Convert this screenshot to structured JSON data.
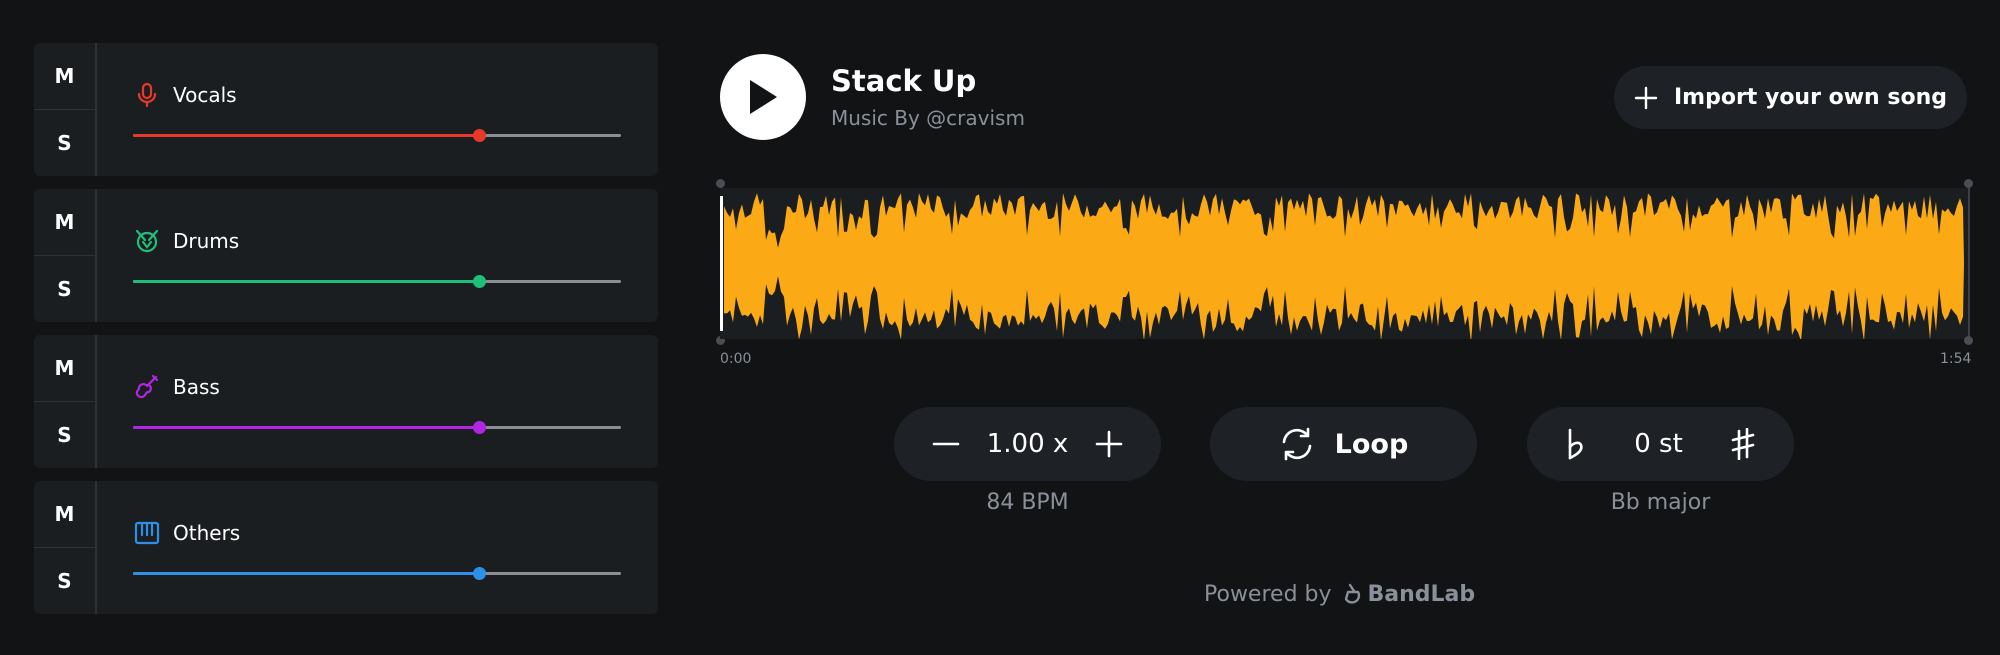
{
  "tracks": [
    {
      "mute_label": "M",
      "solo_label": "S",
      "name": "Vocals",
      "icon": "microphone-icon",
      "color": "#e8382b",
      "volume": 0.71
    },
    {
      "mute_label": "M",
      "solo_label": "S",
      "name": "Drums",
      "icon": "drum-icon",
      "color": "#1fbf7a",
      "volume": 0.71
    },
    {
      "mute_label": "M",
      "solo_label": "S",
      "name": "Bass",
      "icon": "bass-guitar-icon",
      "color": "#b026e3",
      "volume": 0.71
    },
    {
      "mute_label": "M",
      "solo_label": "S",
      "name": "Others",
      "icon": "piano-keys-icon",
      "color": "#2f8fe8",
      "volume": 0.71
    }
  ],
  "player": {
    "title": "Stack Up",
    "artist": "Music By @cravism",
    "import_label": "Import your own song",
    "waveform_color": "#fbaa15",
    "time_start": "0:00",
    "time_end": "1:54"
  },
  "controls": {
    "speed_value": "1.00 x",
    "bpm": "84 BPM",
    "loop_label": "Loop",
    "pitch_value": "0 st",
    "key": "Bb major"
  },
  "footer": {
    "powered_by": "Powered by",
    "brand": "BandLab"
  }
}
